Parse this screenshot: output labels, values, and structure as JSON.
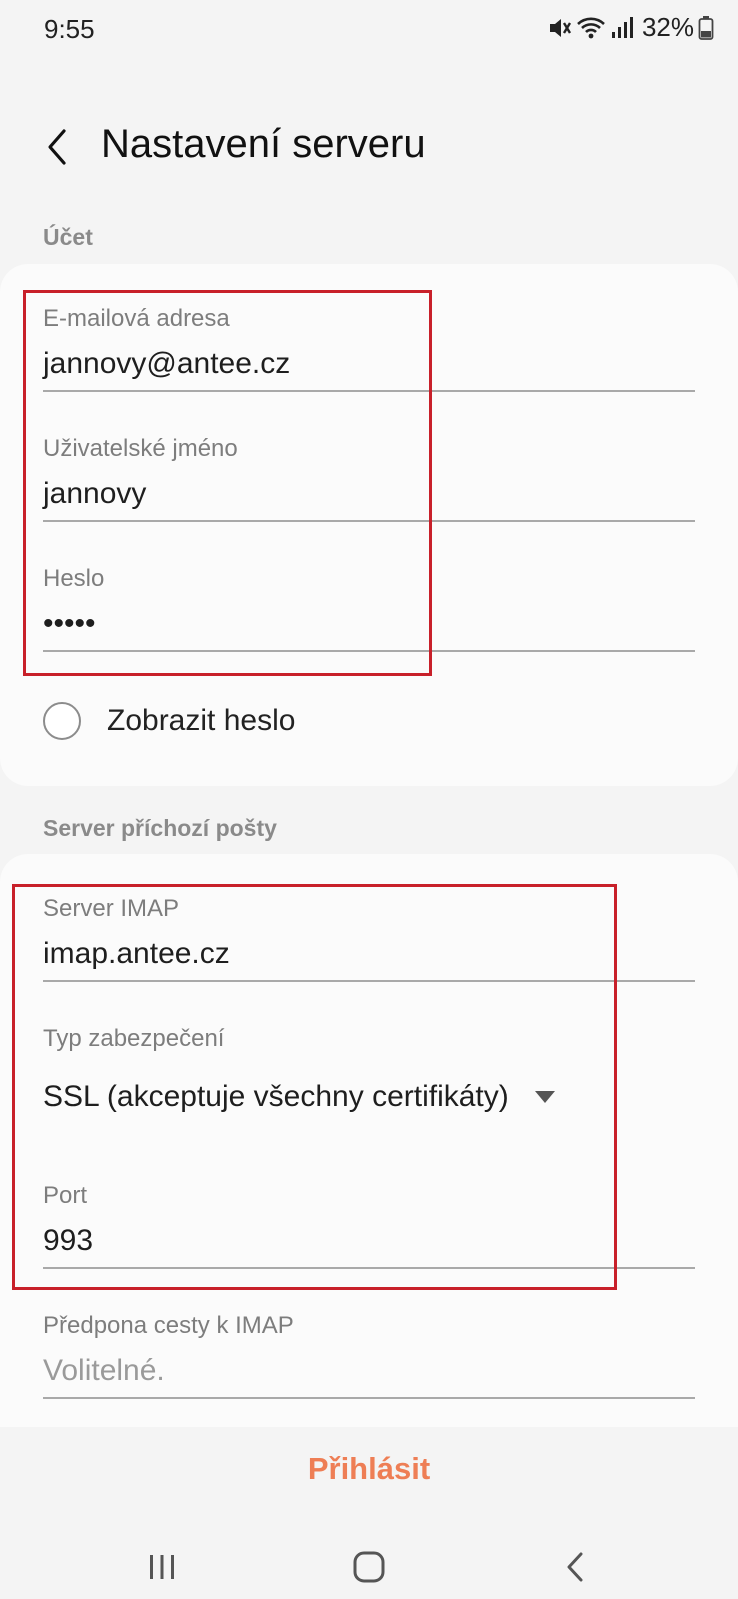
{
  "status": {
    "time": "9:55",
    "battery": "32%",
    "icons": [
      "mute-vibrate-icon",
      "wifi-icon",
      "signal-icon",
      "battery-icon"
    ]
  },
  "header": {
    "title": "Nastavení serveru",
    "back_icon": "chevron-left-icon"
  },
  "account": {
    "section_label": "Účet",
    "email_label": "E-mailová adresa",
    "email_value": "jannovy@antee.cz",
    "username_label": "Uživatelské jméno",
    "username_value": "jannovy",
    "password_label": "Heslo",
    "password_value": "•••••",
    "show_password_label": "Zobrazit heslo"
  },
  "incoming": {
    "section_label": "Server příchozí pošty",
    "imap_label": "Server IMAP",
    "imap_value": "imap.antee.cz",
    "security_label": "Typ zabezpečení",
    "security_value": "SSL (akceptuje všechny certifikáty)",
    "port_label": "Port",
    "port_value": "993",
    "prefix_label": "Předpona cesty k IMAP",
    "prefix_placeholder": "Volitelné."
  },
  "actions": {
    "login_label": "Přihlásit"
  },
  "navigation": {
    "icons": [
      "recent-apps-icon",
      "home-icon",
      "back-icon"
    ]
  },
  "colors": {
    "accent": "#ee7e55",
    "highlight": "#c8202a"
  }
}
